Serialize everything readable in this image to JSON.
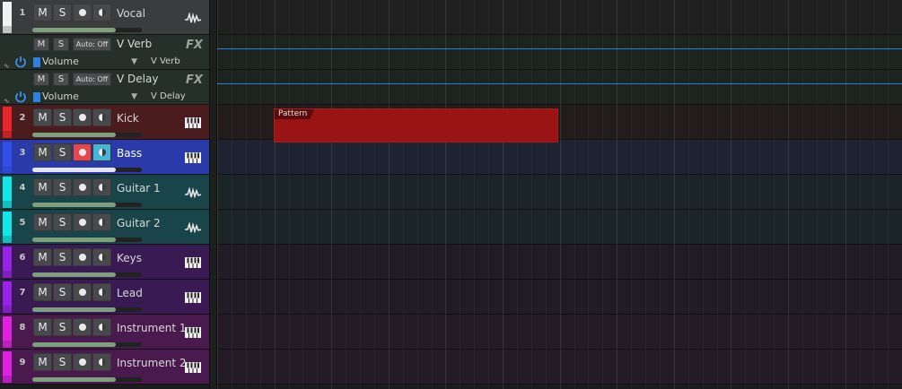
{
  "tracks": [
    {
      "kind": "track",
      "num": "1",
      "name": "Vocal",
      "icon": "waveform-icon",
      "color": "#f2f2f2",
      "bg": "#3b3c3d",
      "lane": "#202021",
      "fader": 0.76,
      "rec": false,
      "mon": false
    },
    {
      "kind": "fx",
      "name": "V Verb",
      "param": "Volume",
      "target": "V Verb",
      "m": "M",
      "s": "S",
      "auto": "Auto: Off",
      "fx": "FX",
      "bg": "#25302a",
      "lane": "#1d2420"
    },
    {
      "kind": "fx",
      "name": "V Delay",
      "param": "Volume",
      "target": "V Delay",
      "m": "M",
      "s": "S",
      "auto": "Auto: Off",
      "fx": "FX",
      "bg": "#25302a",
      "lane": "#1d2420"
    },
    {
      "kind": "track",
      "num": "2",
      "name": "Kick",
      "icon": "piano-keys-icon",
      "color": "#e8262b",
      "bg": "#4a1c1d",
      "lane": "#221c1d",
      "fader": 0.76,
      "rec": false,
      "mon": false
    },
    {
      "kind": "track",
      "num": "3",
      "name": "Bass",
      "icon": "piano-keys-icon",
      "color": "#3350e8",
      "bg": "#2a3aa8",
      "lane": "#1f2230",
      "fader": 0.76,
      "rec": true,
      "mon": true
    },
    {
      "kind": "track",
      "num": "4",
      "name": "Guitar 1",
      "icon": "waveform-icon",
      "color": "#10e8e8",
      "bg": "#19454a",
      "lane": "#1b2527",
      "fader": 0.76,
      "rec": false,
      "mon": false
    },
    {
      "kind": "track",
      "num": "5",
      "name": "Guitar 2",
      "icon": "waveform-icon",
      "color": "#10e8e8",
      "bg": "#19454a",
      "lane": "#1b2527",
      "fader": 0.76,
      "rec": false,
      "mon": false
    },
    {
      "kind": "track",
      "num": "6",
      "name": "Keys",
      "icon": "piano-keys-icon",
      "color": "#9a22e8",
      "bg": "#3a1a52",
      "lane": "#211b26",
      "fader": 0.76,
      "rec": false,
      "mon": false
    },
    {
      "kind": "track",
      "num": "7",
      "name": "Lead",
      "icon": "piano-keys-icon",
      "color": "#9a22e8",
      "bg": "#3a1a52",
      "lane": "#211b26",
      "fader": 0.76,
      "rec": false,
      "mon": false
    },
    {
      "kind": "track",
      "num": "8",
      "name": "Instrument 1",
      "icon": "piano-keys-icon",
      "color": "#e022e0",
      "bg": "#4a1a4e",
      "lane": "#231b26",
      "fader": 0.76,
      "rec": false,
      "mon": false
    },
    {
      "kind": "track",
      "num": "9",
      "name": "Instrument 2",
      "icon": "piano-keys-icon",
      "color": "#e022e0",
      "bg": "#4a1a4e",
      "lane": "#231b26",
      "fader": 0.76,
      "rec": false,
      "mon": false
    }
  ],
  "labels": {
    "mute": "M",
    "solo": "S"
  },
  "pattern": {
    "label": "Pattern",
    "color": "#9a1414"
  },
  "colors": {
    "record_active": "#e8454f",
    "monitor_active": "#48b4d8",
    "automation_line": "#2b7fd8"
  }
}
